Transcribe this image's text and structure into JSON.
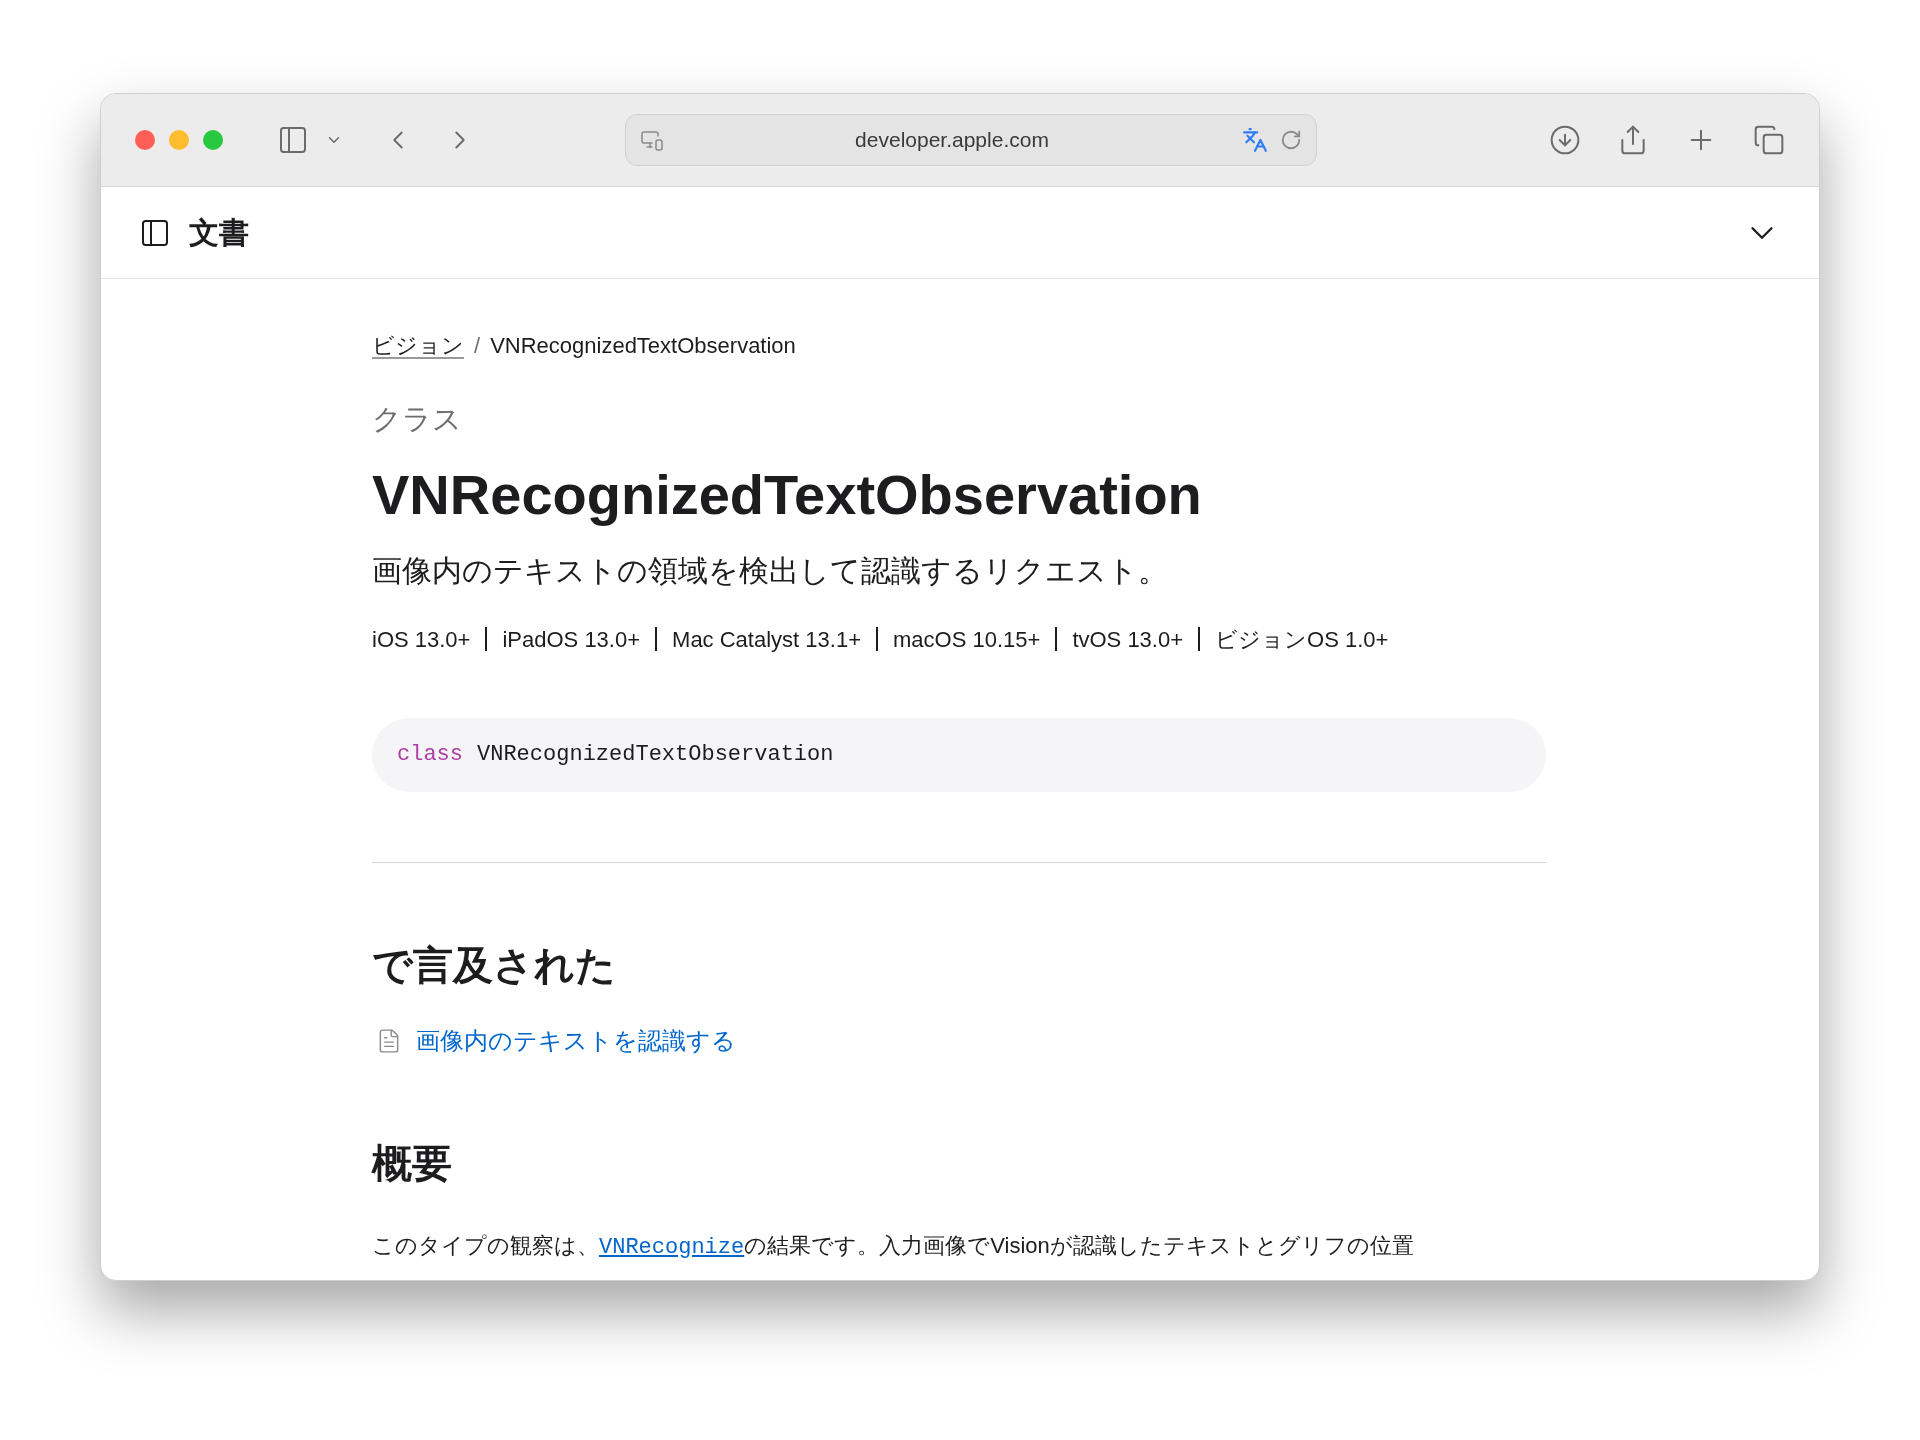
{
  "browser": {
    "address": "developer.apple.com"
  },
  "header": {
    "title": "文書",
    "expanded": false
  },
  "breadcrumb": {
    "separator": "/",
    "items": [
      {
        "label": "ビジョン",
        "link": true
      },
      {
        "label": "VNRecognizedTextObservation",
        "link": false
      }
    ]
  },
  "kind_label": "クラス",
  "title": "VNRecognizedTextObservation",
  "abstract": "画像内のテキストの領域を検出して認識するリクエスト。",
  "platforms": [
    "iOS 13.0+",
    "iPadOS 13.0+",
    "Mac Catalyst 13.1+",
    "macOS 10.15+",
    "tvOS 13.0+",
    "ビジョンOS 1.0+"
  ],
  "declaration": {
    "keyword": "class",
    "name": "VNRecognizedTextObservation"
  },
  "mentioned": {
    "heading": "で言及された",
    "links": [
      "画像内のテキストを認識する"
    ]
  },
  "overview": {
    "heading": "概要",
    "before": "このタイプの観察は、",
    "link": "VNRecognize",
    "after": "の結果です。入力画像でVisionが認識したテキストとグリフの位置"
  }
}
